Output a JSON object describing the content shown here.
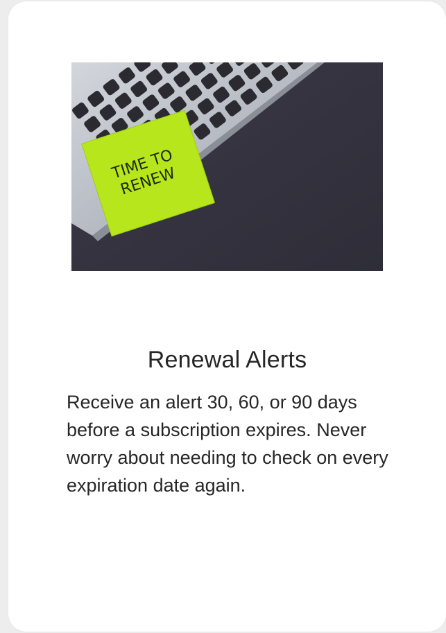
{
  "card": {
    "image": {
      "alt": "keyboard with sticky note",
      "note_text_line1": "TIME TO",
      "note_text_line2": "RENEW",
      "colors": {
        "desk": "#35333f",
        "keyboard_body": "#b9bdc6",
        "keys": "#2a2a30",
        "sticky_note": "#b7e61c"
      }
    },
    "title": "Renewal Alerts",
    "description": "Receive an alert 30, 60, or 90 days before a subscription expires. Never worry about needing to check on every expiration date again."
  }
}
